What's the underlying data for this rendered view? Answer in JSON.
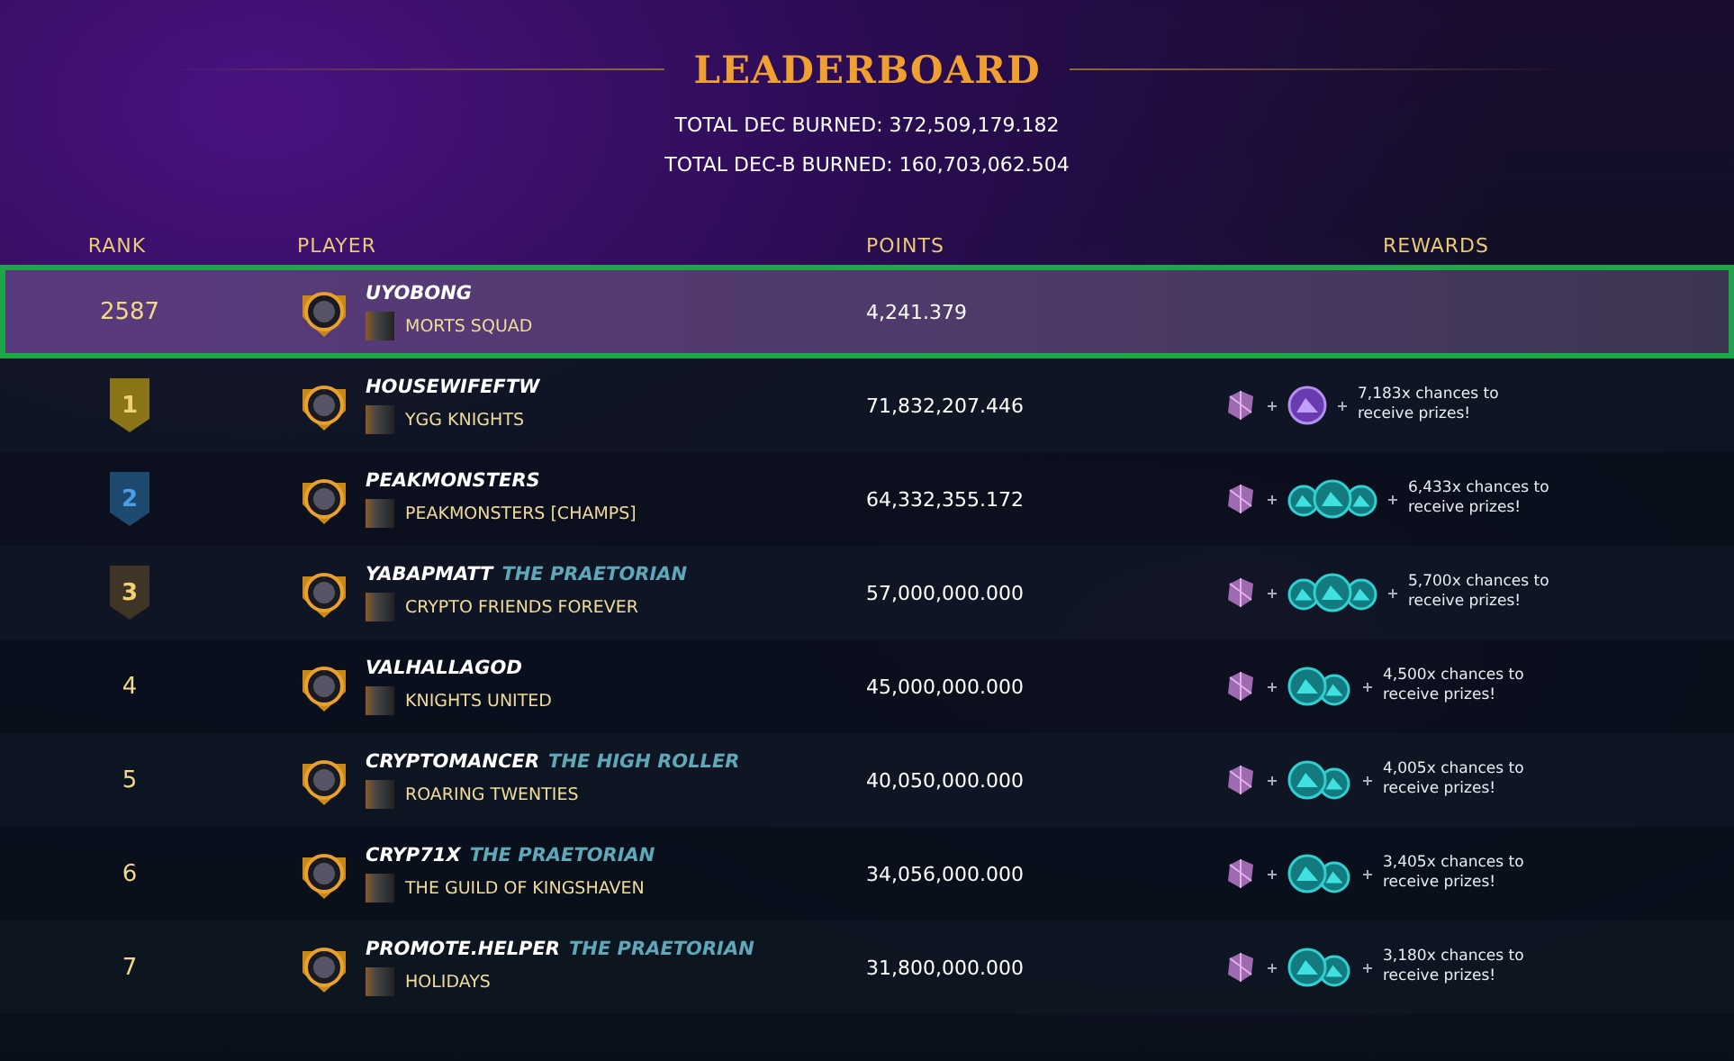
{
  "title": "LEADERBOARD",
  "totals": [
    "TOTAL DEC BURNED: 372,509,179.182",
    "TOTAL DEC-B BURNED: 160,703,062.504"
  ],
  "columns": [
    "RANK",
    "PLAYER",
    "POINTS",
    "REWARDS"
  ],
  "rows": [
    {
      "rank": "2587",
      "kind": "plain",
      "selected": true,
      "player": "UYOBONG",
      "guild": "MORTS SQUAD",
      "points": "4,241.379"
    },
    {
      "rank": "1",
      "kind": "badge",
      "color": "#8a7418",
      "selected": false,
      "player": "HOUSEWIFEFTW",
      "guild": "YGG KNIGHTS",
      "points": "71,832,207.446",
      "reward": {
        "kind": "orb",
        "text": "7,183x chances to receive prizes!"
      }
    },
    {
      "rank": "2",
      "kind": "badge",
      "color": "#1d4a6e",
      "selected": false,
      "player": "PEAKMONSTERS",
      "guild": "PEAKMONSTERS [CHAMPS]",
      "points": "64,332,355.172",
      "reward": {
        "kind": "triple",
        "text": "6,433x chances to receive prizes!"
      }
    },
    {
      "rank": "3",
      "kind": "badge",
      "color": "#3e3527",
      "selected": false,
      "player": "YABAPMATT",
      "player_title": "THE PRAETORIAN",
      "guild": "CRYPTO FRIENDS FOREVER",
      "points": "57,000,000.000",
      "reward": {
        "kind": "triple",
        "text": "5,700x chances to receive prizes!"
      }
    },
    {
      "rank": "4",
      "kind": "plain",
      "selected": false,
      "player": "VALHALLAGOD",
      "guild": "KNIGHTS UNITED",
      "points": "45,000,000.000",
      "reward": {
        "kind": "double",
        "text": "4,500x chances to receive prizes!"
      }
    },
    {
      "rank": "5",
      "kind": "plain",
      "selected": false,
      "player": "CRYPTOMANCER",
      "player_title": "THE HIGH ROLLER",
      "guild": "ROARING TWENTIES",
      "points": "40,050,000.000",
      "reward": {
        "kind": "double",
        "text": "4,005x chances to receive prizes!"
      }
    },
    {
      "rank": "6",
      "kind": "plain",
      "selected": false,
      "player": "CRYP71X",
      "player_title": "THE PRAETORIAN",
      "guild": "THE GUILD OF KINGSHAVEN",
      "points": "34,056,000.000",
      "reward": {
        "kind": "double",
        "text": "3,405x chances to receive prizes!"
      }
    },
    {
      "rank": "7",
      "kind": "plain",
      "selected": false,
      "player": "PROMOTE.HELPER",
      "player_title": "THE PRAETORIAN",
      "guild": "HOLIDAYS",
      "points": "31,800,000.000",
      "reward": {
        "kind": "double",
        "text": "3,180x chances to receive prizes!"
      }
    }
  ]
}
